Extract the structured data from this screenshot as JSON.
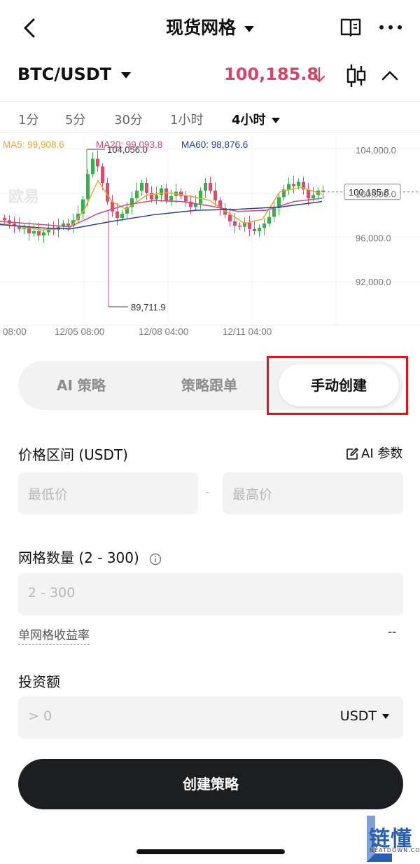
{
  "header": {
    "title": "现货网格",
    "back_icon": "chevron-left-icon",
    "book_icon": "book-icon",
    "more_icon": "more-icon"
  },
  "pair_bar": {
    "pair": "BTC/USDT",
    "price": "100,185.8",
    "price_color": "#d8436a",
    "trend_icon": "arrow-down-icon",
    "chart_type_icon": "candlestick-icon",
    "collapse_icon": "chevron-up-icon"
  },
  "timeframes": [
    {
      "label": "1分",
      "active": false
    },
    {
      "label": "5分",
      "active": false
    },
    {
      "label": "30分",
      "active": false
    },
    {
      "label": "1小时",
      "active": false
    },
    {
      "label": "4小时",
      "active": true
    }
  ],
  "chart": {
    "ma": [
      {
        "label": "MA5: 99,908.6",
        "color": "#e8a532"
      },
      {
        "label": "MA20: 99,093.8",
        "color": "#c94b7a"
      },
      {
        "label": "MA60: 98,876.6",
        "color": "#2d3e8c"
      }
    ],
    "y_ticks": [
      "104,000.0",
      "100,000.0",
      "96,000.0",
      "92,000.0"
    ],
    "x_ticks": [
      "08:00",
      "12/05 08:00",
      "12/08 04:00",
      "12/11 04:00"
    ],
    "high_label": "104,056.0",
    "low_label": "89,711.9",
    "last_price_label": "100,185.8",
    "watermark": "欧易",
    "up_color": "#33b24a",
    "down_color": "#e14a6b"
  },
  "tabs": [
    {
      "label": "AI 策略",
      "active": false
    },
    {
      "label": "策略跟单",
      "active": false
    },
    {
      "label": "手动创建",
      "active": true
    }
  ],
  "form": {
    "price_range_label": "价格区间 (USDT)",
    "ai_param_label": "AI 参数",
    "min_price_placeholder": "最低价",
    "separator": "-",
    "max_price_placeholder": "最高价",
    "grid_count_label": "网格数量 (2 - 300)",
    "grid_count_placeholder": "2 - 300",
    "profit_rate_label": "单网格收益率",
    "profit_rate_value": "--",
    "investment_label": "投资额",
    "investment_placeholder": "> 0",
    "investment_unit": "USDT",
    "submit_label": "创建策略"
  },
  "watermark_brand": {
    "text": "链懂",
    "sub": "NEATDOWN.COM"
  }
}
